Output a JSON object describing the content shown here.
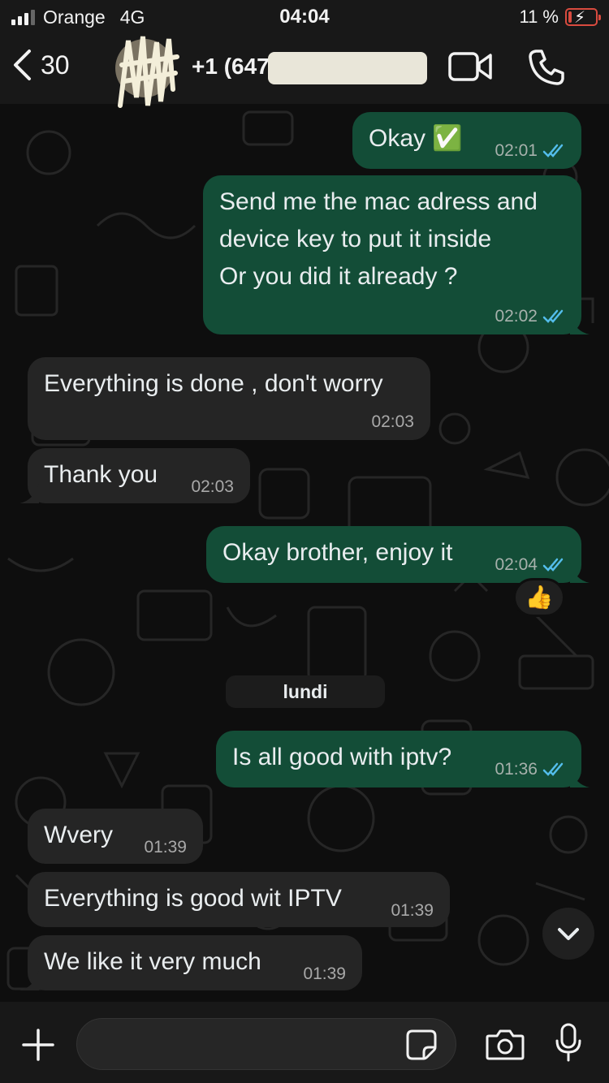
{
  "status_bar": {
    "carrier": "Orange",
    "network": "4G",
    "time": "04:04",
    "battery_percent": "11 %",
    "battery_level": 0.11
  },
  "header": {
    "back_count": "30",
    "contact_name": "+1 (647"
  },
  "messages": [
    {
      "direction": "out",
      "text": "Okay ✅",
      "time": "02:01",
      "read": true
    },
    {
      "direction": "out",
      "text": "Send me the mac adress and\ndevice key to put it inside\nOr you did it already ?",
      "time": "02:02",
      "read": true
    },
    {
      "direction": "in",
      "text": "Everything is done , don't worry",
      "time": "02:03"
    },
    {
      "direction": "in",
      "text": "Thank you",
      "time": "02:03"
    },
    {
      "direction": "out",
      "text": "Okay brother, enjoy it",
      "time": "02:04",
      "read": true,
      "reaction": "👍"
    },
    {
      "direction": "out",
      "text": "Is all good with iptv?",
      "time": "01:36",
      "read": true
    },
    {
      "direction": "in",
      "text": "Wvery",
      "time": "01:39"
    },
    {
      "direction": "in",
      "text": "Everything is good wit IPTV",
      "time": "01:39"
    },
    {
      "direction": "in",
      "text": "We like it very much",
      "time": "01:39"
    }
  ],
  "day_separator": "lundi",
  "reaction_emoji": "👍",
  "composer": {
    "placeholder": ""
  },
  "colors": {
    "outgoing_bubble": "#134d37",
    "incoming_bubble": "#252525",
    "read_ticks": "#53bdeb",
    "background": "#0e0e0e"
  },
  "icons": [
    "back-chevron-icon",
    "video-call-icon",
    "phone-icon",
    "plus-icon",
    "sticker-icon",
    "camera-icon",
    "microphone-icon",
    "chevron-down-icon",
    "double-check-icon"
  ]
}
